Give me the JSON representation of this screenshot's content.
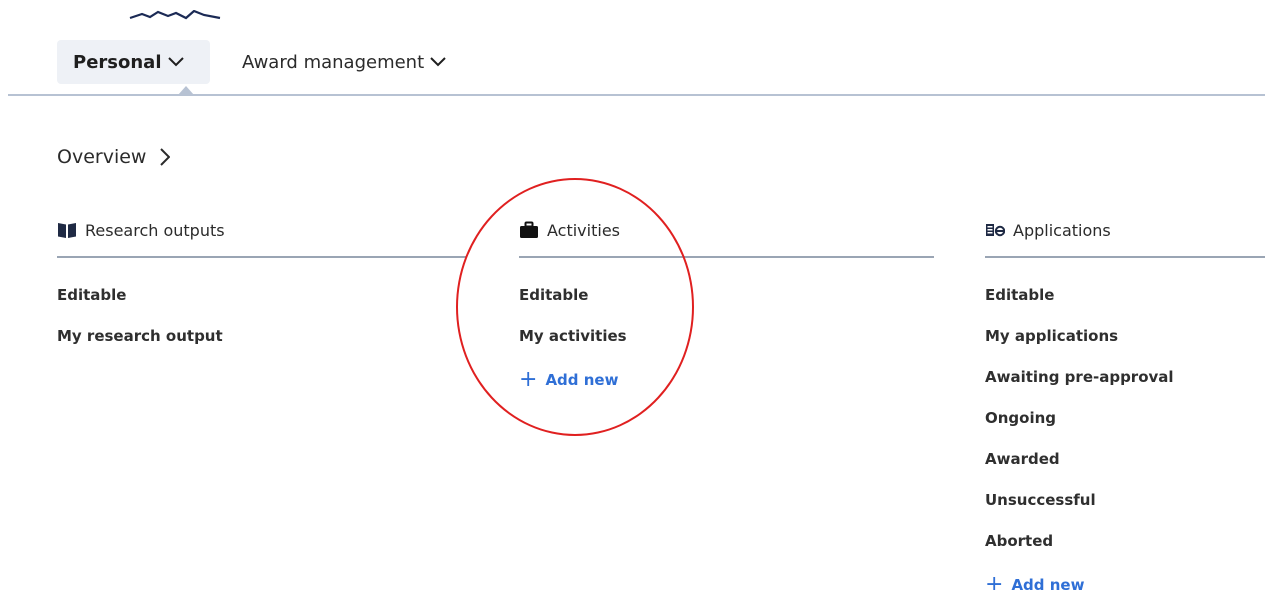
{
  "nav": {
    "tabs": [
      {
        "label": "Personal",
        "active": true
      },
      {
        "label": "Award management",
        "active": false
      }
    ]
  },
  "overview": {
    "label": "Overview"
  },
  "columns": {
    "research": {
      "title": "Research outputs",
      "icon": "book-icon",
      "items": [
        "Editable",
        "My research output"
      ]
    },
    "activities": {
      "title": "Activities",
      "icon": "briefcase-icon",
      "items": [
        "Editable",
        "My activities"
      ],
      "add_label": "Add new"
    },
    "applications": {
      "title": "Applications",
      "icon": "applications-icon",
      "items": [
        "Editable",
        "My applications",
        "Awaiting pre-approval",
        "Ongoing",
        "Awarded",
        "Unsuccessful",
        "Aborted"
      ],
      "add_label": "Add new"
    }
  },
  "colors": {
    "accent": "#2f6fd6",
    "annotation": "#e02020",
    "rule": "#b7c2d3",
    "active_tab_bg": "#eef1f6"
  }
}
